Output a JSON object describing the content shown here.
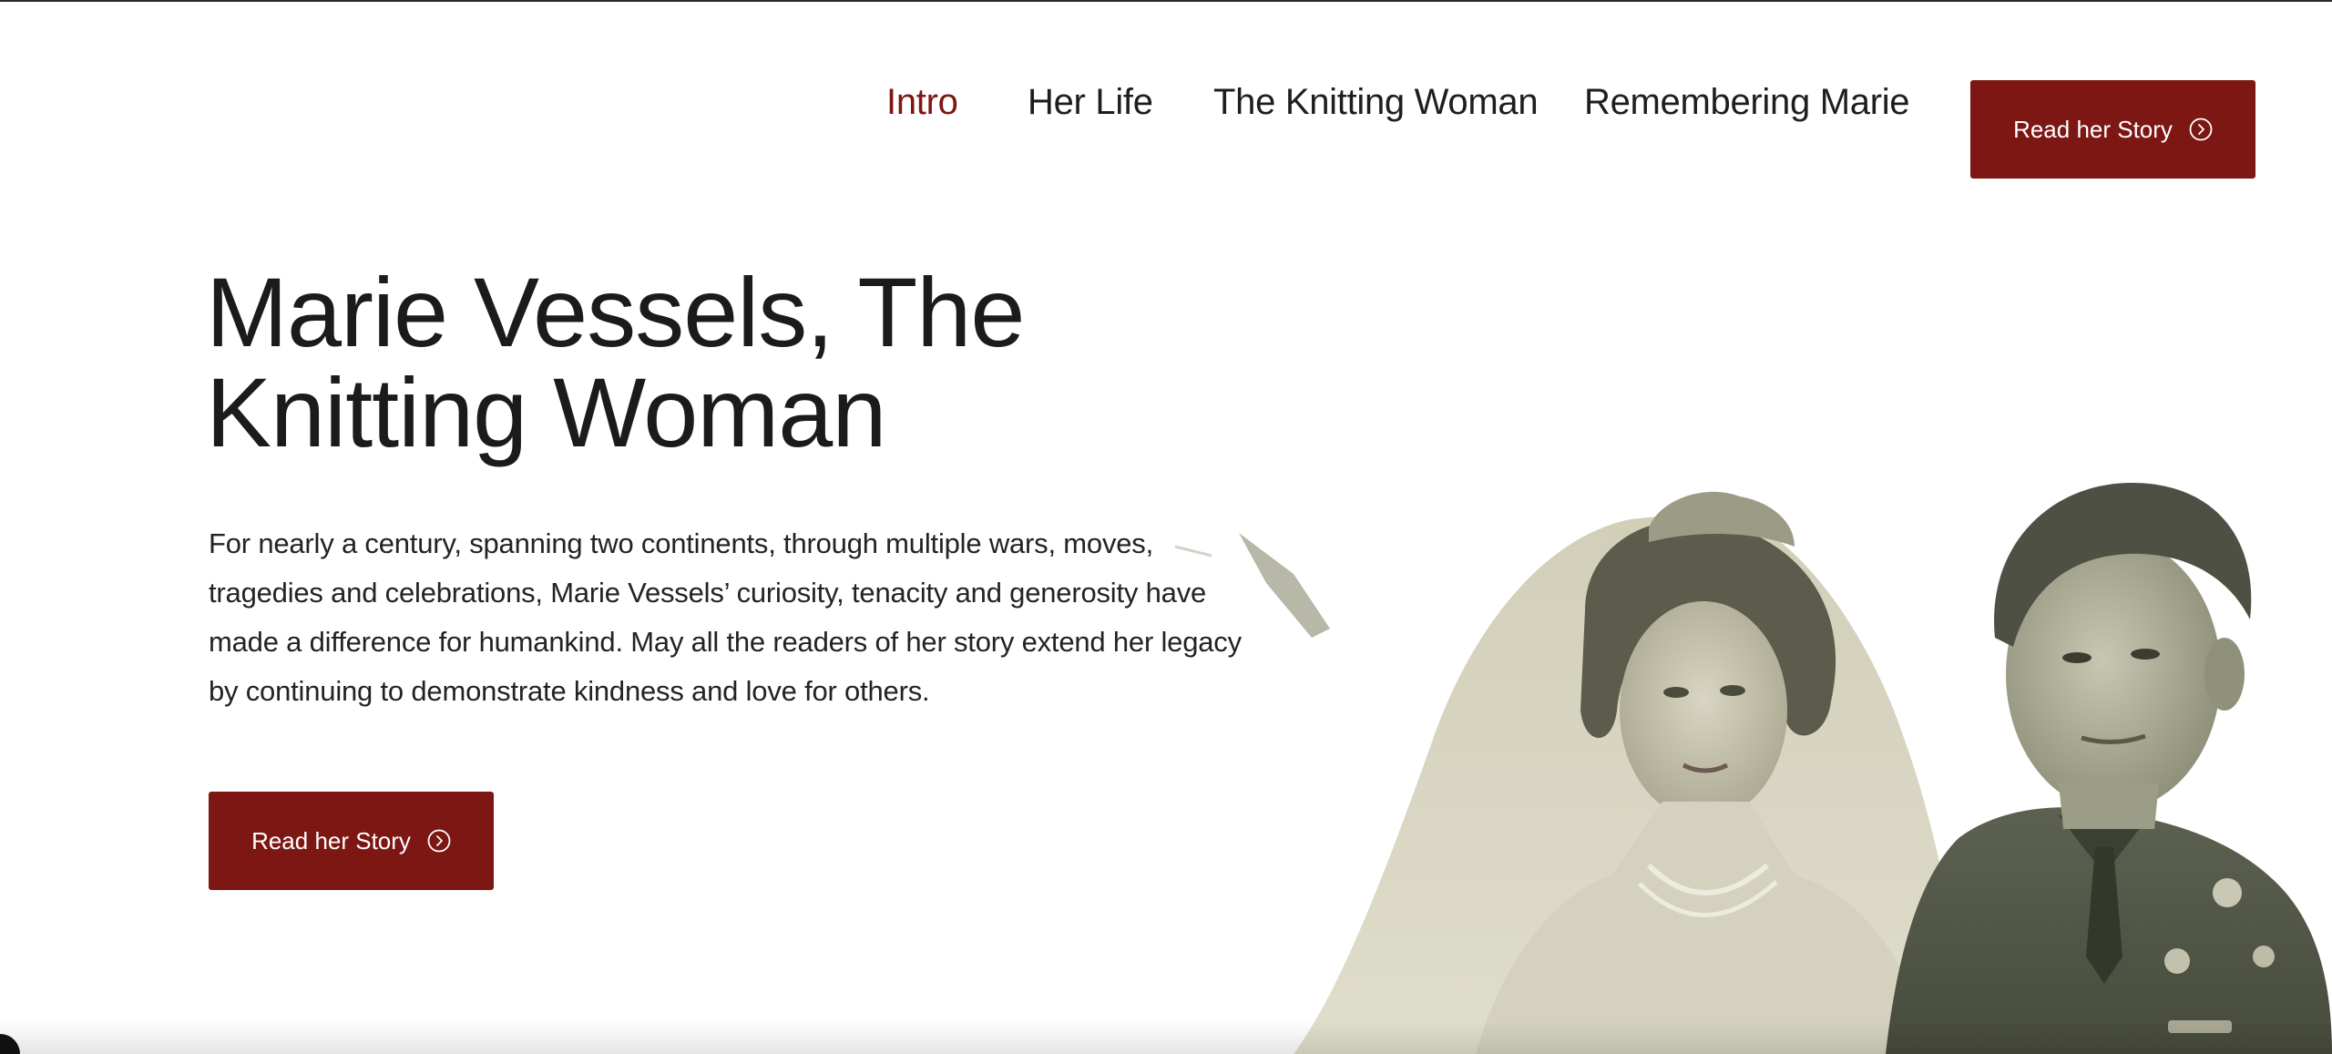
{
  "nav": {
    "links": [
      {
        "label": "Intro",
        "active": true
      },
      {
        "label": "Her Life",
        "active": false
      },
      {
        "label": "The Knitting Woman",
        "active": false
      },
      {
        "label": "Remembering Marie",
        "active": false
      }
    ],
    "cta_label": "Read her Story",
    "cta_icon": "arrow-circle-right-icon"
  },
  "hero": {
    "title_line1": "Marie Vessels, The",
    "title_line2": "Knitting Woman",
    "description": "For nearly a century, spanning two continents, through multiple wars, moves, tragedies and celebrations, Marie Vessels’ curiosity, tenacity and generosity have made a difference for humankind. May all the readers of her story extend her legacy by continuing to demonstrate kindness and love for others.",
    "cta_label": "Read her Story",
    "cta_icon": "arrow-circle-right-icon"
  },
  "colors": {
    "accent": "#7c1713",
    "text": "#1e1e1e",
    "background": "#ffffff"
  }
}
